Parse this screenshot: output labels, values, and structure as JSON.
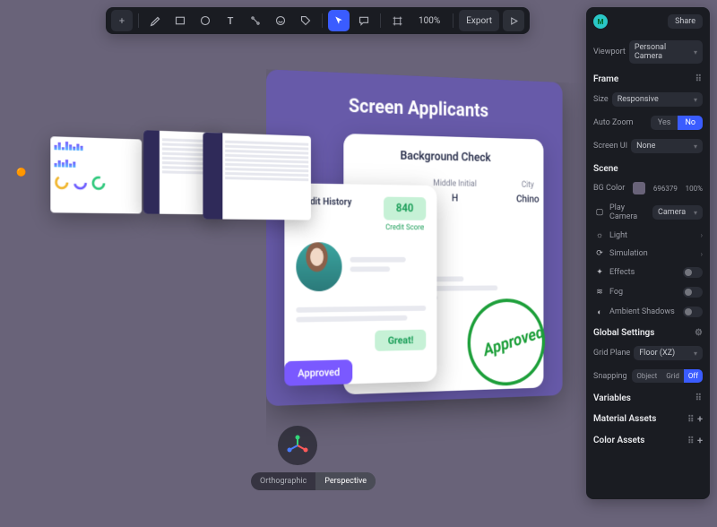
{
  "toolbar": {
    "zoom": "100%",
    "export": "Export"
  },
  "panel": {
    "user_initial": "M",
    "share": "Share",
    "viewport": {
      "label": "Viewport",
      "camera": "Personal Camera"
    },
    "frame": {
      "label": "Frame",
      "size_label": "Size",
      "size_value": "Responsive",
      "autozoom_label": "Auto Zoom",
      "yes": "Yes",
      "no": "No",
      "screenui_label": "Screen UI",
      "screenui_value": "None"
    },
    "scene": {
      "label": "Scene",
      "bgcolor_label": "BG Color",
      "hex": "696379",
      "opacity": "100%",
      "playcamera_label": "Play Camera",
      "playcamera_value": "Camera",
      "items": {
        "light": "Light",
        "simulation": "Simulation",
        "effects": "Effects",
        "fog": "Fog",
        "ambient": "Ambient Shadows"
      }
    },
    "global": {
      "label": "Global Settings",
      "gridplane_label": "Grid Plane",
      "gridplane_value": "Floor (XZ)",
      "snapping_label": "Snapping",
      "object": "Object",
      "grid": "Grid",
      "off": "Off"
    },
    "variables": "Variables",
    "material": "Material Assets",
    "color": "Color Assets"
  },
  "canvas": {
    "hero_title": "Screen Applicants",
    "bg_check": "Background Check",
    "col1_label": "Middle Initial",
    "col1_value": "H",
    "col2_label": "City",
    "col2_value": "Chino",
    "cf_label": "Credit History",
    "score": "840",
    "score_sub": "Credit Score",
    "great": "Great!",
    "approved_pill": "Approved",
    "stamp": "Approved"
  },
  "camswitch": {
    "ortho": "Orthographic",
    "persp": "Perspective"
  }
}
